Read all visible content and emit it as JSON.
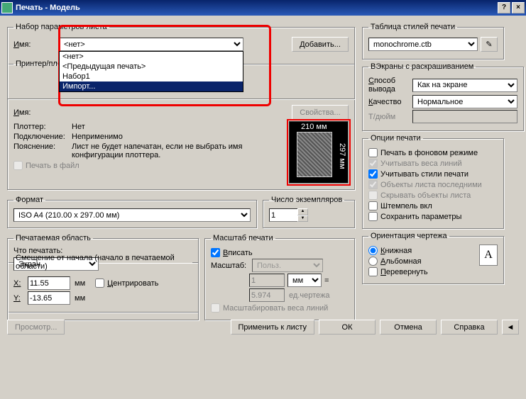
{
  "window": {
    "title": "Печать - Модель"
  },
  "pageSetup": {
    "legend": "Набор параметров листа",
    "nameLabel": "Имя:",
    "selected": "<нет>",
    "options": [
      "<нет>",
      "<Предыдущая печать>",
      "Набор1",
      "Импорт..."
    ],
    "addBtn": "Добавить..."
  },
  "printer": {
    "legend": "Принтер/плоттер",
    "nameLabel": "Имя:",
    "propsBtn": "Свойства...",
    "plotterLabel": "Плоттер:",
    "plotterVal": "Нет",
    "connLabel": "Подключение:",
    "connVal": "Неприменимо",
    "descLabel": "Пояснение:",
    "descVal": "Лист не будет напечатан, если не выбрать имя конфигурации плоттера.",
    "toFile": "Печать в файл",
    "previewW": "210 мм",
    "previewH": "297 мм"
  },
  "paper": {
    "legend": "Формат",
    "value": "ISO A4 (210.00 x 297.00 мм)"
  },
  "copies": {
    "legend": "Число экземпляров",
    "value": "1"
  },
  "area": {
    "legend": "Печатаемая область",
    "whatLabel": "Что печатать:",
    "value": "Экран"
  },
  "scale": {
    "legend": "Масштаб печати",
    "fit": "Вписать",
    "scaleLabel": "Масштаб:",
    "scaleVal": "Польз.",
    "unitNum": "1",
    "unitSel": "мм",
    "drawNum": "5.974",
    "drawUnit": "ед.чертежа",
    "scaleLw": "Масштабировать веса линий"
  },
  "offset": {
    "legend": "Смещение от начала (начало в печатаемой области)",
    "xLabel": "X:",
    "xVal": "11.55",
    "yLabel": "Y:",
    "yVal": "-13.65",
    "mm": "мм",
    "center": "Центрировать"
  },
  "styleTable": {
    "legend": "Таблица стилей печати",
    "value": "monochrome.ctb"
  },
  "shaded": {
    "legend": "ВЭкраны с раскрашиванием",
    "modeLabel": "Способ вывода",
    "modeVal": "Как на экране",
    "qualLabel": "Качество",
    "qualVal": "Нормальное",
    "dpiLabel": "Т/дюйм"
  },
  "options": {
    "legend": "Опции печати",
    "bg": "Печать в фоновом режиме",
    "lw": "Учитывать веса линий",
    "styles": "Учитывать стили печати",
    "last": "Объекты листа последними",
    "hide": "Скрывать объекты листа",
    "stamp": "Штемпель вкл",
    "save": "Сохранить параметры"
  },
  "orient": {
    "legend": "Ориентация чертежа",
    "portrait": "Книжная",
    "landscape": "Альбомная",
    "upside": "Перевернуть"
  },
  "buttons": {
    "preview": "Просмотр...",
    "apply": "Применить к листу",
    "ok": "ОК",
    "cancel": "Отмена",
    "help": "Справка"
  }
}
